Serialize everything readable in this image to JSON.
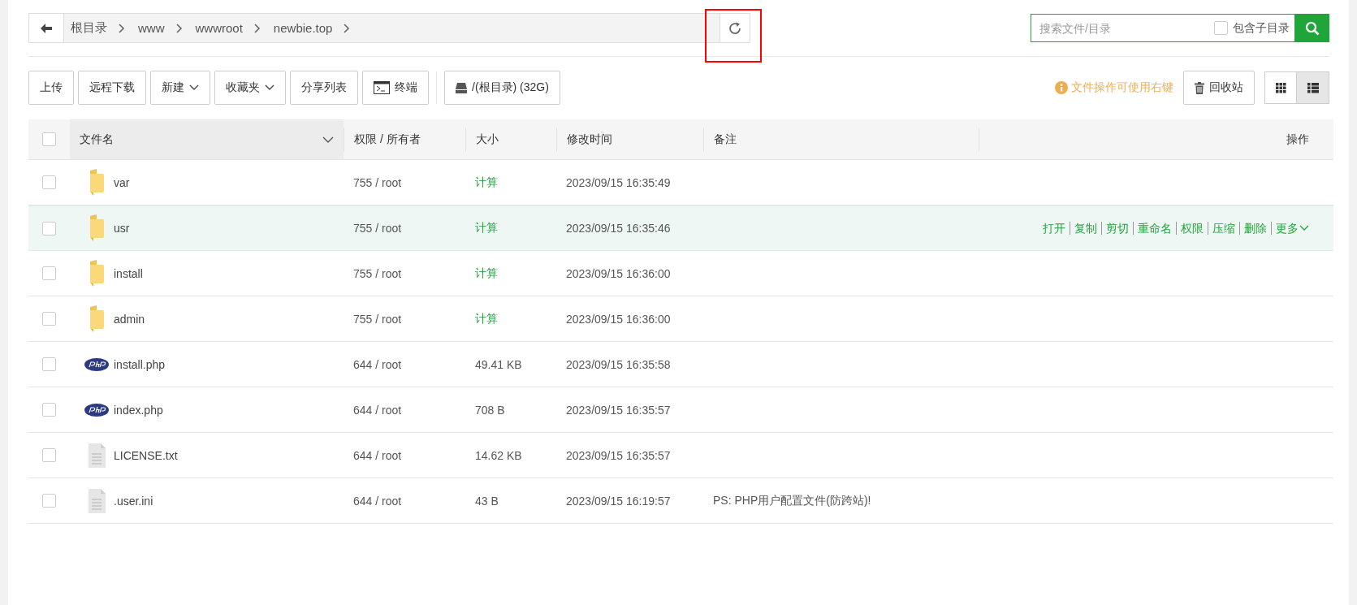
{
  "breadcrumb": {
    "items": [
      "根目录",
      "www",
      "wwwroot",
      "newbie.top"
    ]
  },
  "search": {
    "placeholder": "搜索文件/目录",
    "include_subdirs": {
      "label": "包含子目录",
      "checked": false
    }
  },
  "toolbar": {
    "buttons": [
      {
        "label": "上传",
        "kind": "plain"
      },
      {
        "label": "远程下载",
        "kind": "plain"
      },
      {
        "label": "新建",
        "kind": "dropdown"
      },
      {
        "label": "收藏夹",
        "kind": "dropdown"
      },
      {
        "label": "分享列表",
        "kind": "plain"
      },
      {
        "label": "终端",
        "kind": "terminal"
      },
      {
        "label": "/(根目录) (32G)",
        "kind": "disk"
      }
    ],
    "hint": "文件操作可使用右键",
    "recycle": "回收站",
    "views": [
      {
        "kind": "grid",
        "selected": false
      },
      {
        "kind": "list",
        "selected": true
      }
    ]
  },
  "table": {
    "select_all": {
      "checked": false
    },
    "columns": [
      "文件名",
      "权限 / 所有者",
      "大小",
      "修改时间",
      "备注",
      "操作"
    ],
    "rows": [
      {
        "kind": "folder",
        "name": "var",
        "perm": "755 / root",
        "size": {
          "kind": "link",
          "text": "计算"
        },
        "time": "2023/09/15 16:35:49",
        "checked": false,
        "selected": false
      },
      {
        "kind": "folder",
        "name": "usr",
        "perm": "755 / root",
        "size": {
          "kind": "link",
          "text": "计算"
        },
        "time": "2023/09/15 16:35:46",
        "checked": false,
        "selected": true,
        "actions": [
          "打开",
          "复制",
          "剪切",
          "重命名",
          "权限",
          "压缩",
          "删除",
          "更多"
        ]
      },
      {
        "kind": "folder",
        "name": "install",
        "perm": "755 / root",
        "size": {
          "kind": "link",
          "text": "计算"
        },
        "time": "2023/09/15 16:36:00",
        "checked": false,
        "selected": false
      },
      {
        "kind": "folder",
        "name": "admin",
        "perm": "755 / root",
        "size": {
          "kind": "link",
          "text": "计算"
        },
        "time": "2023/09/15 16:36:00",
        "checked": false,
        "selected": false
      },
      {
        "kind": "php",
        "name": "install.php",
        "perm": "644 / root",
        "size": {
          "kind": "text",
          "text": "49.41 KB"
        },
        "time": "2023/09/15 16:35:58",
        "checked": false,
        "selected": false
      },
      {
        "kind": "php",
        "name": "index.php",
        "perm": "644 / root",
        "size": {
          "kind": "text",
          "text": "708 B"
        },
        "time": "2023/09/15 16:35:57",
        "checked": false,
        "selected": false
      },
      {
        "kind": "text",
        "name": "LICENSE.txt",
        "perm": "644 / root",
        "size": {
          "kind": "text",
          "text": "14.62 KB"
        },
        "time": "2023/09/15 16:35:57",
        "checked": false,
        "selected": false
      },
      {
        "kind": "text",
        "name": ".user.ini",
        "perm": "644 / root",
        "size": {
          "kind": "text",
          "text": "43 B"
        },
        "time": "2023/09/15 16:19:57",
        "note": "PS: PHP用户配置文件(防跨站)!",
        "checked": false,
        "selected": false
      }
    ]
  }
}
